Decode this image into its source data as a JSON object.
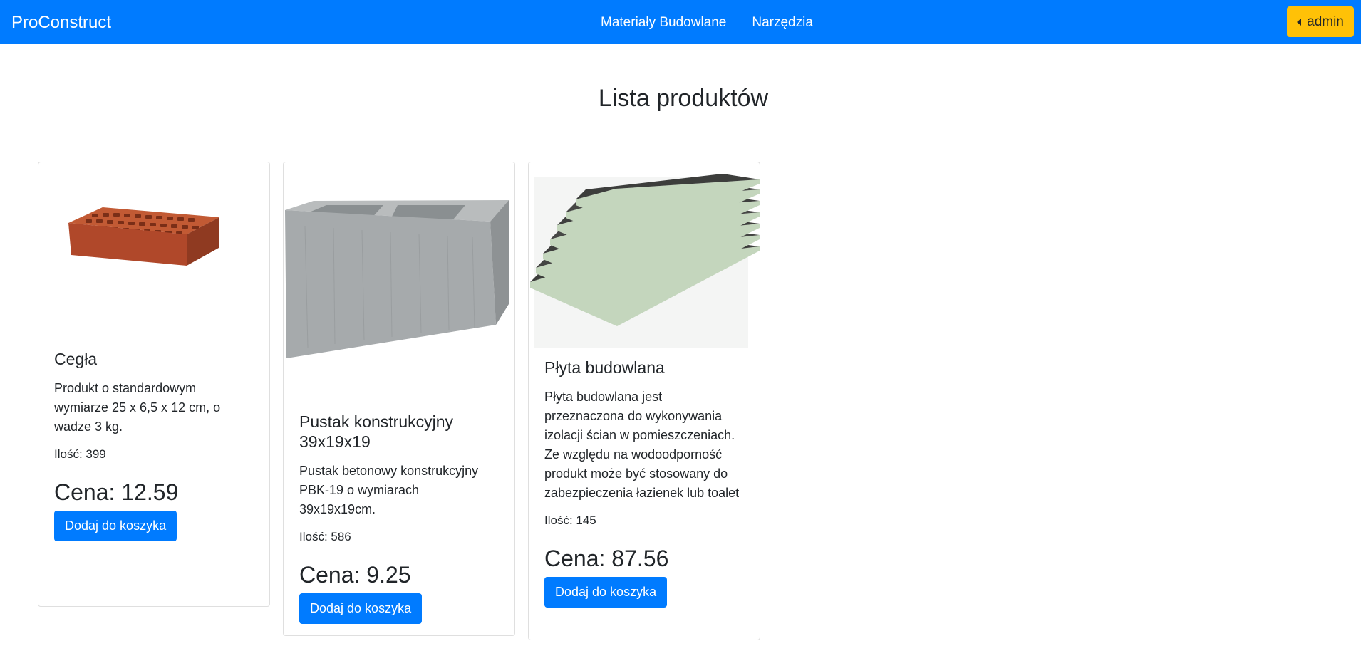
{
  "navbar": {
    "brand": "ProConstruct",
    "links": [
      "Materiały Budowlane",
      "Narzędzia"
    ],
    "user_button": "admin",
    "background": "#007bff",
    "user_button_color": "#ffc107"
  },
  "page": {
    "title": "Lista produktów"
  },
  "products": [
    {
      "name": "Cegła",
      "description": "Produkt o standardowym wymiarze 25 x 6,5 x 12 cm, o wadze 3 kg.",
      "quantity": "Ilość: 399",
      "price": "Cena: 12.59",
      "button": "Dodaj do koszyka"
    },
    {
      "name": "Pustak konstrukcyjny 39x19x19",
      "description": "Pustak betonowy konstrukcyjny PBK-19 o wymiarach 39x19x19cm.",
      "quantity": "Ilość: 586",
      "price": "Cena: 9.25",
      "button": "Dodaj do koszyka"
    },
    {
      "name": "Płyta budowlana",
      "description": "Płyta budowlana jest przeznaczona do wykonywania izolacji ścian w pomieszczeniach. Ze względu na wodoodporność produkt może być stosowany do zabezpieczenia łazienek lub toalet",
      "quantity": "Ilość: 145",
      "price": "Cena: 87.56",
      "button": "Dodaj do koszyka"
    }
  ]
}
